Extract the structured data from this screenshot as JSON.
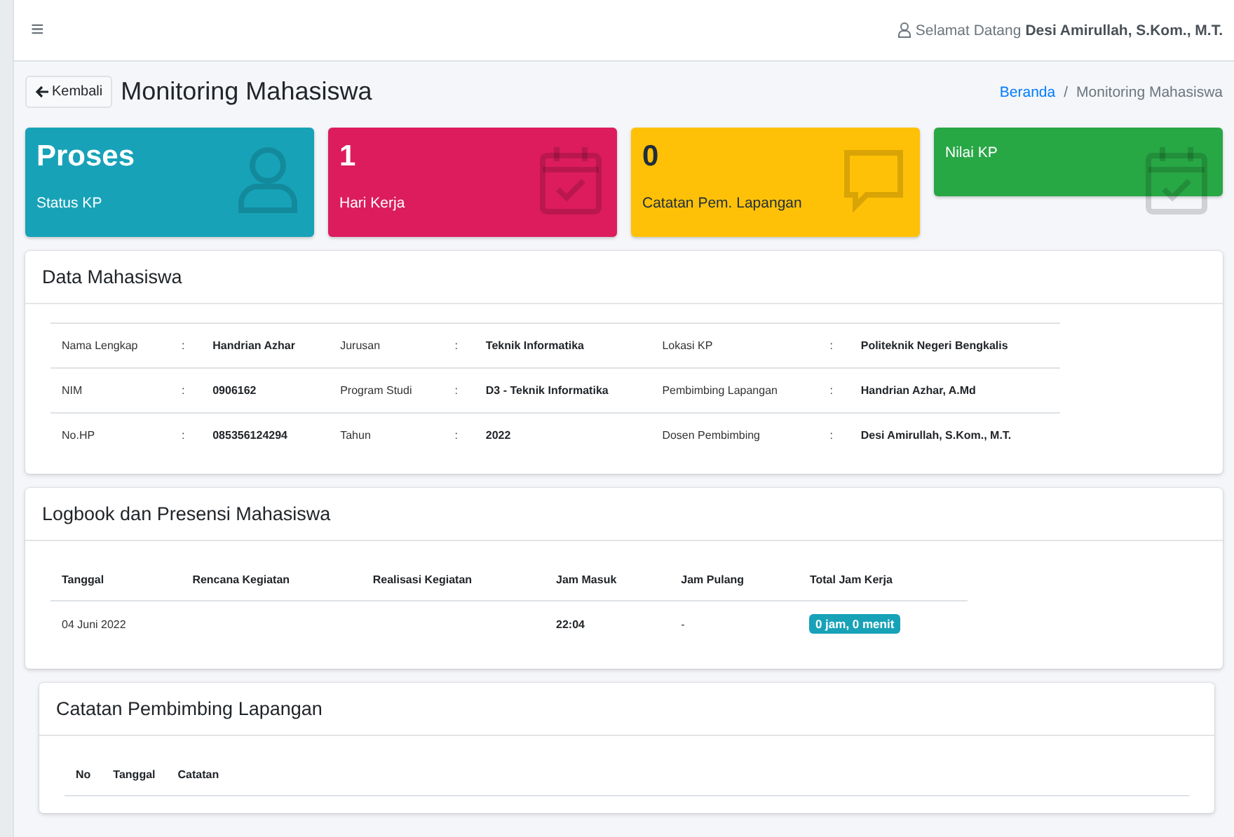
{
  "navbar": {
    "menu_icon": "≡",
    "welcome_prefix": "Selamat Datang",
    "user_name": "Desi Amirullah, S.Kom., M.T."
  },
  "header": {
    "back_button": "Kembali",
    "title": "Monitoring Mahasiswa",
    "breadcrumb_separator": "/",
    "breadcrumb": [
      {
        "label": "Beranda",
        "link": true
      },
      {
        "label": "Monitoring Mahasiswa",
        "link": false
      }
    ]
  },
  "stat_cards": [
    {
      "value": "Proses",
      "label": "Status KP",
      "color": "#17a2b8",
      "kind": "user"
    },
    {
      "value": "1",
      "label": "Hari Kerja",
      "color": "#dc1c5d",
      "kind": "calendar"
    },
    {
      "value": "0",
      "label": "Catatan Pem. Lapangan",
      "color": "#ffc107",
      "kind": "chat"
    },
    {
      "label": "Nilai KP",
      "color": "#28a745",
      "kind": "calendar"
    }
  ],
  "student_data": {
    "title": "Data Mahasiswa",
    "rows": [
      [
        {
          "label": "Nama Lengkap",
          "separator": ":",
          "value": "Handrian Azhar"
        },
        {
          "label": "Jurusan",
          "separator": ":",
          "value": "Teknik Informatika"
        },
        {
          "label": "Lokasi KP",
          "separator": ":",
          "value": "Politeknik Negeri Bengkalis"
        }
      ],
      [
        {
          "label": "NIM",
          "separator": ":",
          "value": "0906162"
        },
        {
          "label": "Program Studi",
          "separator": ":",
          "value": "D3 - Teknik Informatika"
        },
        {
          "label": "Pembimbing Lapangan",
          "separator": ":",
          "value": "Handrian Azhar, A.Md"
        }
      ],
      [
        {
          "label": "No.HP",
          "separator": ":",
          "value": "085356124294"
        },
        {
          "label": "Tahun",
          "separator": ":",
          "value": "2022"
        },
        {
          "label": "Dosen Pembimbing",
          "separator": ":",
          "value": "Desi Amirullah, S.Kom., M.T."
        }
      ]
    ]
  },
  "logbook": {
    "title": "Logbook dan Presensi Mahasiswa",
    "columns": [
      "Tanggal",
      "Rencana Kegiatan",
      "Realisasi Kegiatan",
      "Jam Masuk",
      "Jam Pulang",
      "Total Jam Kerja"
    ],
    "rows": [
      {
        "tanggal": "04 Juni 2022",
        "jam_masuk": "22:04",
        "jam_pulang": "-",
        "total": "0 jam, 0 menit"
      }
    ]
  },
  "notes": {
    "title": "Catatan Pembimbing Lapangan",
    "columns": [
      "No",
      "Tanggal",
      "Catatan"
    ]
  }
}
